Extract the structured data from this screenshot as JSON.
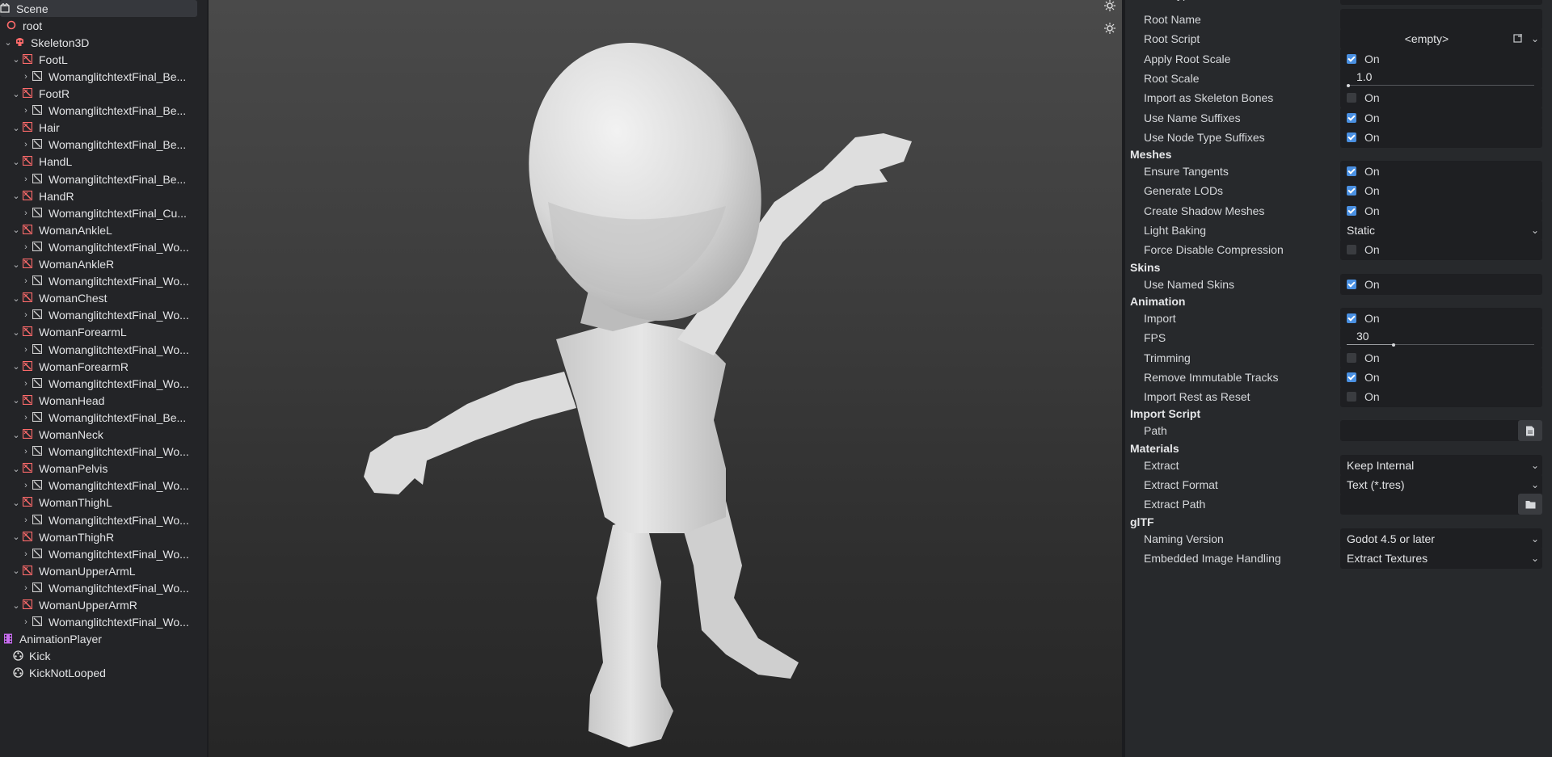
{
  "tree": {
    "items": [
      {
        "label": "Scene",
        "type": "scene",
        "arrow": "",
        "selected": true
      },
      {
        "label": "root",
        "type": "node3d",
        "arrow": ""
      },
      {
        "label": "Skeleton3D",
        "type": "skeleton",
        "arrow": "⌄"
      },
      {
        "label": "FootL",
        "type": "bone",
        "arrow": "⌄"
      },
      {
        "label": "WomanglitchtextFinal_Be...",
        "type": "mesh",
        "arrow": "›"
      },
      {
        "label": "FootR",
        "type": "bone",
        "arrow": "⌄"
      },
      {
        "label": "WomanglitchtextFinal_Be...",
        "type": "mesh",
        "arrow": "›"
      },
      {
        "label": "Hair",
        "type": "bone",
        "arrow": "⌄"
      },
      {
        "label": "WomanglitchtextFinal_Be...",
        "type": "mesh",
        "arrow": "›"
      },
      {
        "label": "HandL",
        "type": "bone",
        "arrow": "⌄"
      },
      {
        "label": "WomanglitchtextFinal_Be...",
        "type": "mesh",
        "arrow": "›"
      },
      {
        "label": "HandR",
        "type": "bone",
        "arrow": "⌄"
      },
      {
        "label": "WomanglitchtextFinal_Cu...",
        "type": "mesh",
        "arrow": "›"
      },
      {
        "label": "WomanAnkleL",
        "type": "bone",
        "arrow": "⌄"
      },
      {
        "label": "WomanglitchtextFinal_Wo...",
        "type": "mesh",
        "arrow": "›"
      },
      {
        "label": "WomanAnkleR",
        "type": "bone",
        "arrow": "⌄"
      },
      {
        "label": "WomanglitchtextFinal_Wo...",
        "type": "mesh",
        "arrow": "›"
      },
      {
        "label": "WomanChest",
        "type": "bone",
        "arrow": "⌄"
      },
      {
        "label": "WomanglitchtextFinal_Wo...",
        "type": "mesh",
        "arrow": "›"
      },
      {
        "label": "WomanForearmL",
        "type": "bone",
        "arrow": "⌄"
      },
      {
        "label": "WomanglitchtextFinal_Wo...",
        "type": "mesh",
        "arrow": "›"
      },
      {
        "label": "WomanForearmR",
        "type": "bone",
        "arrow": "⌄"
      },
      {
        "label": "WomanglitchtextFinal_Wo...",
        "type": "mesh",
        "arrow": "›"
      },
      {
        "label": "WomanHead",
        "type": "bone",
        "arrow": "⌄"
      },
      {
        "label": "WomanglitchtextFinal_Be...",
        "type": "mesh",
        "arrow": "›"
      },
      {
        "label": "WomanNeck",
        "type": "bone",
        "arrow": "⌄"
      },
      {
        "label": "WomanglitchtextFinal_Wo...",
        "type": "mesh",
        "arrow": "›"
      },
      {
        "label": "WomanPelvis",
        "type": "bone",
        "arrow": "⌄"
      },
      {
        "label": "WomanglitchtextFinal_Wo...",
        "type": "mesh",
        "arrow": "›"
      },
      {
        "label": "WomanThighL",
        "type": "bone",
        "arrow": "⌄"
      },
      {
        "label": "WomanglitchtextFinal_Wo...",
        "type": "mesh",
        "arrow": "›"
      },
      {
        "label": "WomanThighR",
        "type": "bone",
        "arrow": "⌄"
      },
      {
        "label": "WomanglitchtextFinal_Wo...",
        "type": "mesh",
        "arrow": "›"
      },
      {
        "label": "WomanUpperArmL",
        "type": "bone",
        "arrow": "⌄"
      },
      {
        "label": "WomanglitchtextFinal_Wo...",
        "type": "mesh",
        "arrow": "›"
      },
      {
        "label": "WomanUpperArmR",
        "type": "bone",
        "arrow": "⌄"
      },
      {
        "label": "WomanglitchtextFinal_Wo...",
        "type": "mesh",
        "arrow": "›"
      },
      {
        "label": "AnimationPlayer",
        "type": "animplayer",
        "arrow": ""
      },
      {
        "label": "Kick",
        "type": "anim",
        "arrow": ""
      },
      {
        "label": "KickNotLooped",
        "type": "anim",
        "arrow": ""
      }
    ]
  },
  "inspector": {
    "rows": [
      {
        "kind": "prop",
        "label": "Root Type",
        "control": "text",
        "value": ""
      },
      {
        "kind": "prop",
        "label": "Root Name",
        "control": "text",
        "value": ""
      },
      {
        "kind": "prop",
        "label": "Root Script",
        "control": "resource",
        "value": "<empty>"
      },
      {
        "kind": "prop",
        "label": "Apply Root Scale",
        "control": "check",
        "checked": true,
        "text": "On"
      },
      {
        "kind": "prop",
        "label": "Root Scale",
        "control": "slider",
        "value": "1.0",
        "fraction": 0.01
      },
      {
        "kind": "prop",
        "label": "Import as Skeleton Bones",
        "control": "check",
        "checked": false,
        "text": "On"
      },
      {
        "kind": "prop",
        "label": "Use Name Suffixes",
        "control": "check",
        "checked": true,
        "text": "On"
      },
      {
        "kind": "prop",
        "label": "Use Node Type Suffixes",
        "control": "check",
        "checked": true,
        "text": "On"
      },
      {
        "kind": "section",
        "label": "Meshes"
      },
      {
        "kind": "prop",
        "label": "Ensure Tangents",
        "control": "check",
        "checked": true,
        "text": "On"
      },
      {
        "kind": "prop",
        "label": "Generate LODs",
        "control": "check",
        "checked": true,
        "text": "On"
      },
      {
        "kind": "prop",
        "label": "Create Shadow Meshes",
        "control": "check",
        "checked": true,
        "text": "On"
      },
      {
        "kind": "prop",
        "label": "Light Baking",
        "control": "dropdown",
        "value": "Static"
      },
      {
        "kind": "prop",
        "label": "Force Disable Compression",
        "control": "check",
        "checked": false,
        "text": "On"
      },
      {
        "kind": "section",
        "label": "Skins"
      },
      {
        "kind": "prop",
        "label": "Use Named Skins",
        "control": "check",
        "checked": true,
        "text": "On"
      },
      {
        "kind": "section",
        "label": "Animation"
      },
      {
        "kind": "prop",
        "label": "Import",
        "control": "check",
        "checked": true,
        "text": "On"
      },
      {
        "kind": "prop",
        "label": "FPS",
        "control": "slider",
        "value": "30",
        "fraction": 0.25
      },
      {
        "kind": "prop",
        "label": "Trimming",
        "control": "check",
        "checked": false,
        "text": "On"
      },
      {
        "kind": "prop",
        "label": "Remove Immutable Tracks",
        "control": "check",
        "checked": true,
        "text": "On"
      },
      {
        "kind": "prop",
        "label": "Import Rest as Reset",
        "control": "check",
        "checked": false,
        "text": "On"
      },
      {
        "kind": "section",
        "label": "Import Script"
      },
      {
        "kind": "prop",
        "label": "Path",
        "control": "file",
        "value": ""
      },
      {
        "kind": "section",
        "label": "Materials"
      },
      {
        "kind": "prop",
        "label": "Extract",
        "control": "dropdown",
        "value": "Keep Internal"
      },
      {
        "kind": "prop",
        "label": "Extract Format",
        "control": "dropdown",
        "value": "Text (*.tres)"
      },
      {
        "kind": "prop",
        "label": "Extract Path",
        "control": "folder",
        "value": ""
      },
      {
        "kind": "section",
        "label": "glTF"
      },
      {
        "kind": "prop",
        "label": "Naming Version",
        "control": "dropdown",
        "value": "Godot 4.5 or later"
      },
      {
        "kind": "prop",
        "label": "Embedded Image Handling",
        "control": "dropdown",
        "value": "Extract Textures"
      }
    ]
  },
  "colors": {
    "accent": "#4a90e2",
    "bone_red": "#ff5f5f",
    "anim_purple": "#c86cf0"
  }
}
